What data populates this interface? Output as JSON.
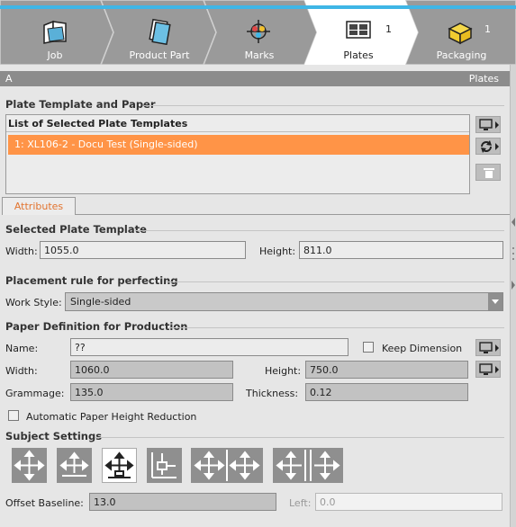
{
  "workflow": {
    "steps": [
      {
        "label": "Job",
        "count": "",
        "active": false
      },
      {
        "label": "Product Part",
        "count": "",
        "active": false
      },
      {
        "label": "Marks",
        "count": "",
        "active": false
      },
      {
        "label": "Plates",
        "count": "1",
        "active": true
      },
      {
        "label": "Packaging",
        "count": "1",
        "active": false
      }
    ],
    "accent": "#3fb6e6"
  },
  "panel_header": {
    "left": "A",
    "right": "Plates"
  },
  "plate_template": {
    "section_title": "Plate Template and Paper",
    "list_header": "List of Selected Plate Templates",
    "items": [
      "1: XL106-2 - Docu Test (Single-sided)"
    ],
    "selected_color": "#ff9447"
  },
  "tabs": {
    "attributes": "Attributes"
  },
  "selected_plate": {
    "section_title": "Selected Plate Template",
    "width_label": "Width:",
    "width_value": "1055.0",
    "height_label": "Height:",
    "height_value": "811.0"
  },
  "placement": {
    "section_title": "Placement rule for perfecting",
    "work_style_label": "Work Style:",
    "work_style_value": "Single-sided"
  },
  "paper": {
    "section_title": "Paper Definition for Production",
    "name_label": "Name:",
    "name_value": "??",
    "keep_dimension_label": "Keep Dimension",
    "width_label": "Width:",
    "width_value": "1060.0",
    "height_label": "Height:",
    "height_value": "750.0",
    "grammage_label": "Grammage:",
    "grammage_value": "135.0",
    "thickness_label": "Thickness:",
    "thickness_value": "0.12",
    "auto_reduction_label": "Automatic Paper Height Reduction"
  },
  "subject": {
    "section_title": "Subject Settings",
    "offset_label": "Offset Baseline:",
    "offset_value": "13.0",
    "left_label": "Left:",
    "left_value": "0.0"
  }
}
